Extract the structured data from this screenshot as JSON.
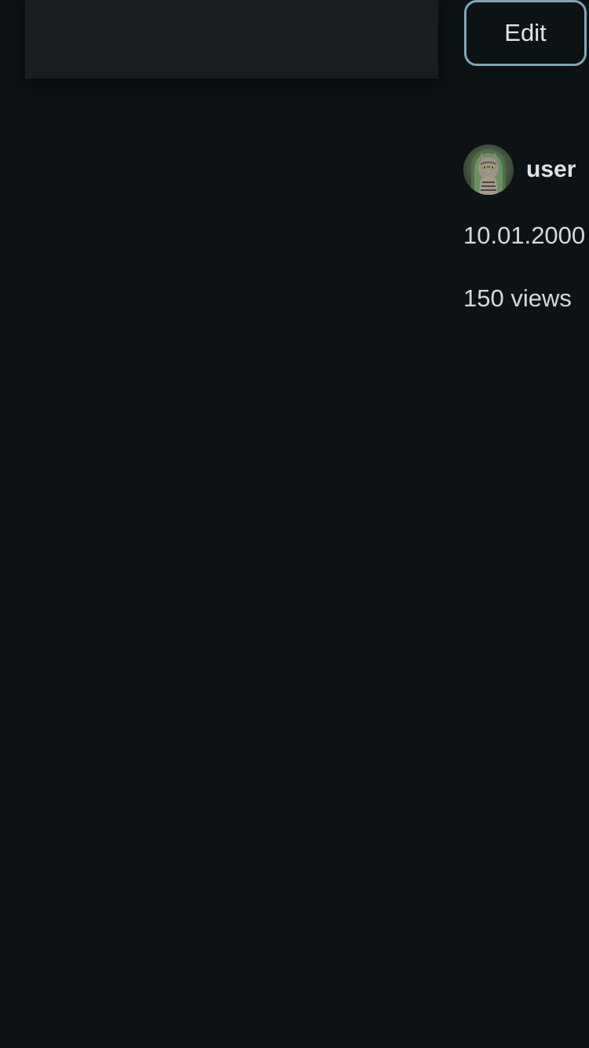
{
  "article": {
    "edit_label": "Edit"
  },
  "author": {
    "username": "user",
    "avatar_icon": "cat-avatar-icon"
  },
  "meta": {
    "date": "10.01.2000",
    "views": "150 views"
  },
  "colors": {
    "background": "#0d1215",
    "card": "#171d20",
    "button_border": "#7fa6b8"
  }
}
